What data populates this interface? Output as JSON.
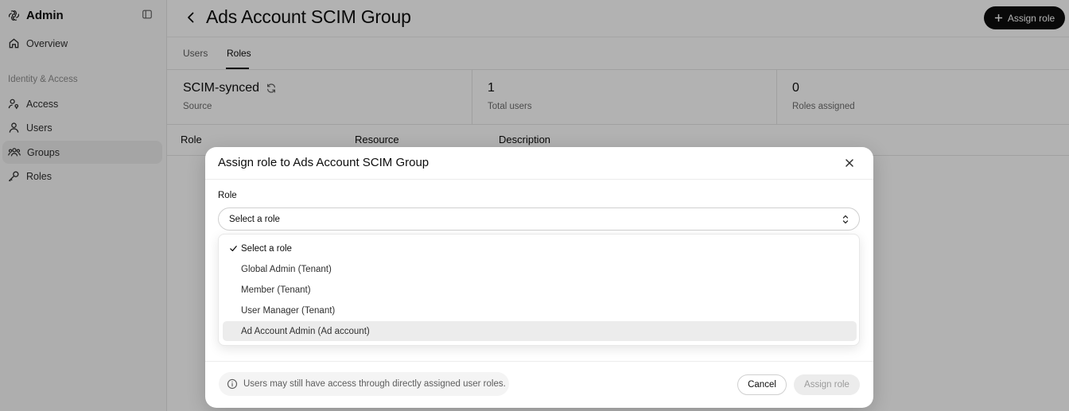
{
  "sidebar": {
    "brand": "Admin",
    "brand_icon": "openai-logo-icon",
    "items": [
      {
        "label": "Overview",
        "icon": "home-icon"
      },
      {
        "label": "Access",
        "icon": "person-key-icon"
      },
      {
        "label": "Users",
        "icon": "user-icon"
      },
      {
        "label": "Groups",
        "icon": "users-group-icon",
        "active": true
      },
      {
        "label": "Roles",
        "icon": "key-icon"
      }
    ],
    "section_label": "Identity & Access"
  },
  "header": {
    "title": "Ads Account SCIM Group",
    "assign_role_label": "Assign role"
  },
  "tabs": [
    {
      "label": "Users"
    },
    {
      "label": "Roles",
      "active": true
    }
  ],
  "stats": [
    {
      "value": "SCIM-synced",
      "label": "Source"
    },
    {
      "value": "1",
      "label": "Total users"
    },
    {
      "value": "0",
      "label": "Roles assigned"
    }
  ],
  "table": {
    "columns": [
      "Role",
      "Resource",
      "Description"
    ]
  },
  "modal": {
    "title": "Assign role to Ads Account SCIM Group",
    "field_label": "Role",
    "select_value": "Select a role",
    "options": [
      "Select a role",
      "Global Admin (Tenant)",
      "Member (Tenant)",
      "User Manager (Tenant)",
      "Ad Account Admin (Ad account)"
    ],
    "selected_option": "Select a role",
    "highlighted_option": "Ad Account Admin (Ad account)",
    "notice": "Users may still have access through directly assigned user roles.",
    "cancel_label": "Cancel",
    "assign_label": "Assign role"
  },
  "colors": {
    "primary": "#0d0d0d",
    "sidebar_bg": "#f9f9f9",
    "overlay": "rgba(0,0,0,0.30)"
  }
}
